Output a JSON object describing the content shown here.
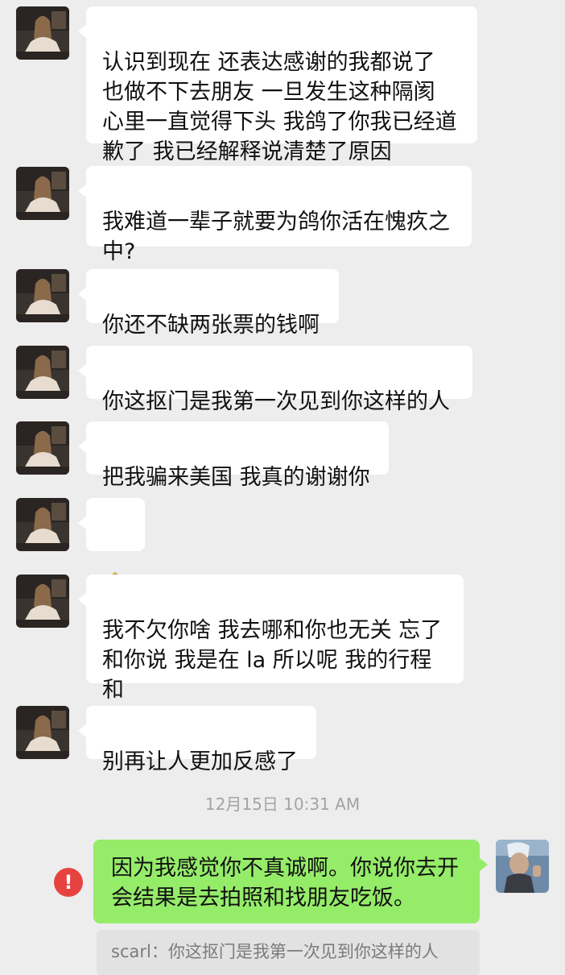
{
  "colors": {
    "background": "#ededed",
    "incoming_bubble": "#ffffff",
    "outgoing_bubble": "#95ec69",
    "error": "#e64340",
    "timestamp": "#a3a3a3"
  },
  "messages": [
    {
      "sender": "other",
      "text": "认识到现在 还表达感谢的我都说了\n也做不下去朋友 一旦发生这种隔阂\n心里一直觉得下头 我鸽了你我已经道\n歉了 我已经解释说清楚了原因"
    },
    {
      "sender": "other",
      "text": "我难道一辈子就要为鸽你活在愧疚之\n中?"
    },
    {
      "sender": "other",
      "text": "你还不缺两张票的钱啊"
    },
    {
      "sender": "other",
      "text": "你这抠门是我第一次见到你这样的人"
    },
    {
      "sender": "other",
      "text": "把我骗来美国 我真的谢谢你"
    },
    {
      "sender": "other",
      "emoji": "folded-hands-emoji"
    },
    {
      "sender": "other",
      "text": "我不欠你啥 我去哪和你也无关 忘了\n和你说 我是在 la 所以呢 我的行程和\n你有啥关系呢?"
    },
    {
      "sender": "other",
      "text": "别再让人更加反感了"
    }
  ],
  "timestamp": "12月15日 10:31 AM",
  "outgoing": {
    "text": "因为我感觉你不真诚啊。你说你去开会结果是去拍照和找朋友吃饭。",
    "status": "send-failed",
    "status_icon": "!",
    "quote": "scarl：你这抠门是我第一次见到你这样的人"
  }
}
